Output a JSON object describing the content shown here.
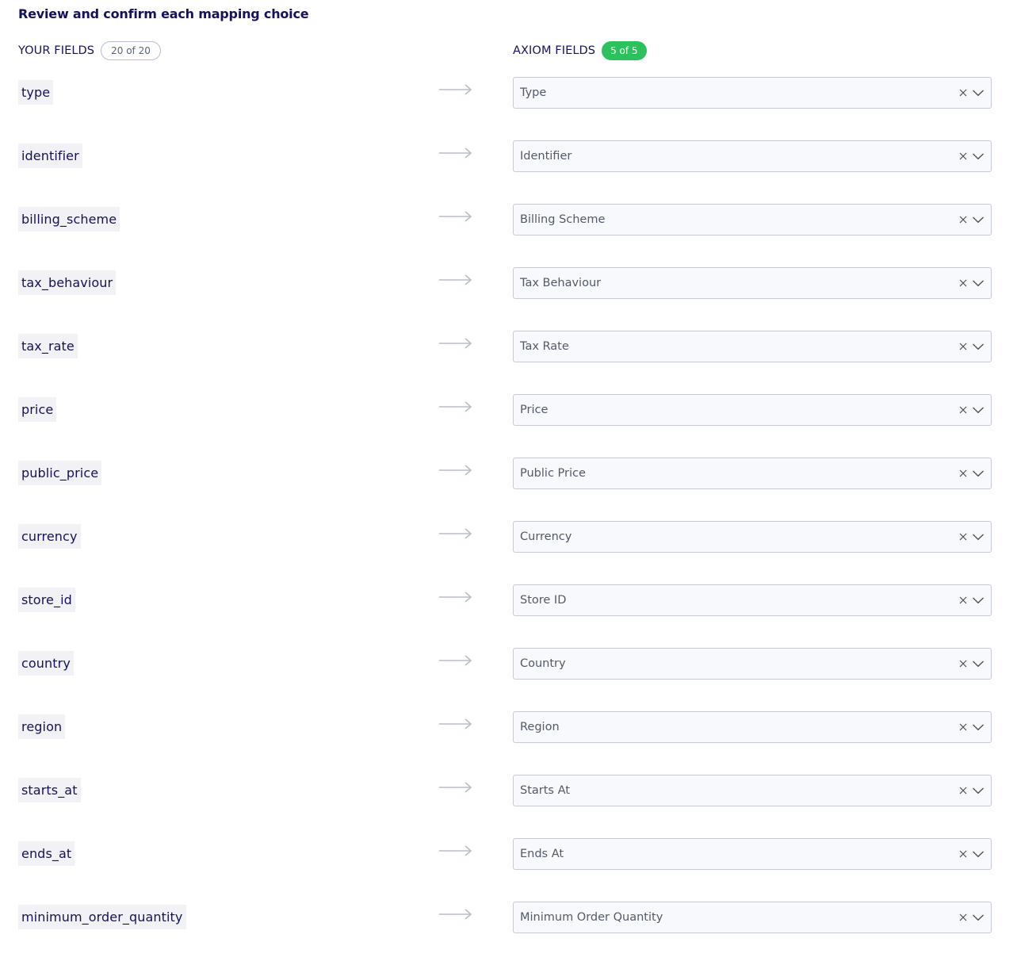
{
  "heading": "Review and confirm each mapping choice",
  "your_fields": {
    "title": "YOUR FIELDS",
    "count": "20 of 20"
  },
  "axiom_fields": {
    "title": "AXIOM FIELDS",
    "count": "5 of 5"
  },
  "colors": {
    "text_dark_navy": "#14125c",
    "field_chip_bg": "#f1f1f6",
    "select_bg": "#f8f9fc",
    "select_border": "#c6cad6",
    "badge_green": "#2bc25d",
    "arrow_gray": "#b9bdc8"
  },
  "icons": {
    "arrow": "arrow-right-icon",
    "clear": "close-icon",
    "dropdown": "chevron-down-icon"
  },
  "mappings": [
    {
      "source": "type",
      "target": "Type"
    },
    {
      "source": "identifier",
      "target": "Identifier"
    },
    {
      "source": "billing_scheme",
      "target": "Billing Scheme"
    },
    {
      "source": "tax_behaviour",
      "target": "Tax Behaviour"
    },
    {
      "source": "tax_rate",
      "target": "Tax Rate"
    },
    {
      "source": "price",
      "target": "Price"
    },
    {
      "source": "public_price",
      "target": "Public Price"
    },
    {
      "source": "currency",
      "target": "Currency"
    },
    {
      "source": "store_id",
      "target": "Store ID"
    },
    {
      "source": "country",
      "target": "Country"
    },
    {
      "source": "region",
      "target": "Region"
    },
    {
      "source": "starts_at",
      "target": "Starts At"
    },
    {
      "source": "ends_at",
      "target": "Ends At"
    },
    {
      "source": "minimum_order_quantity",
      "target": "Minimum Order Quantity"
    }
  ]
}
